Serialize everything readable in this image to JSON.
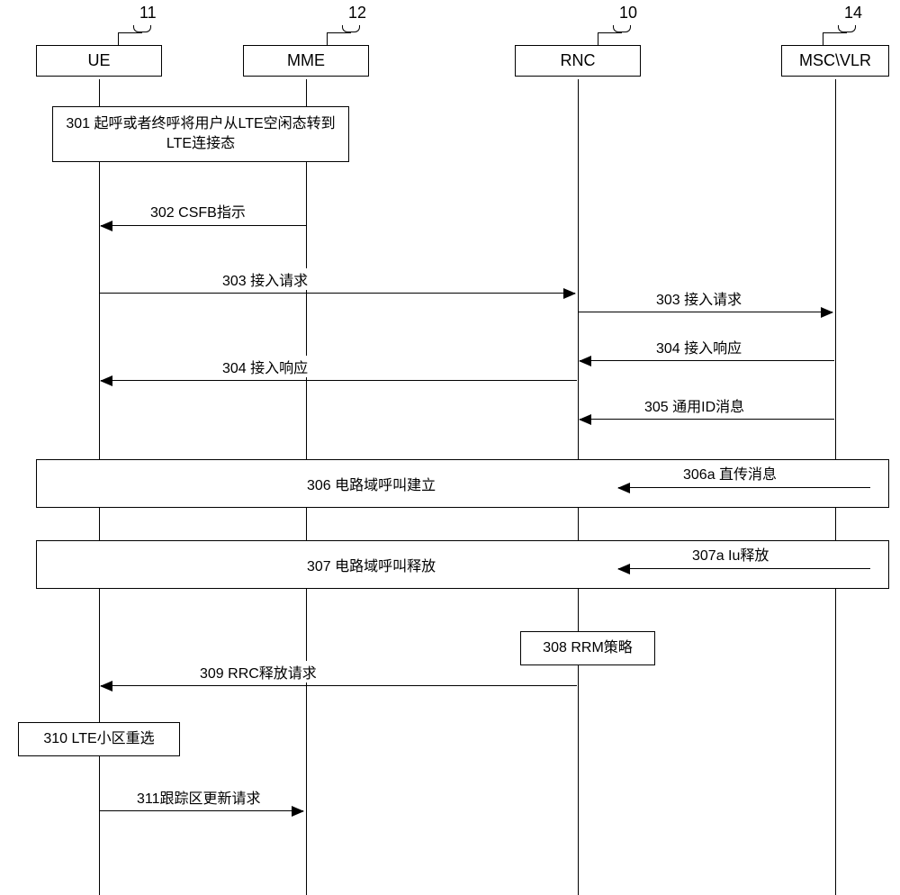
{
  "participants": {
    "ue": {
      "num": "11",
      "label": "UE"
    },
    "mme": {
      "num": "12",
      "label": "MME"
    },
    "rnc": {
      "num": "10",
      "label": "RNC"
    },
    "msc": {
      "num": "14",
      "label": "MSC\\VLR"
    }
  },
  "steps": {
    "s301": "301 起呼或者终呼将用户从LTE空闲态转到LTE连接态",
    "s302": "302 CSFB指示",
    "s303a": "303 接入请求",
    "s303b": "303 接入请求",
    "s304a": "304 接入响应",
    "s304b": "304 接入响应",
    "s305": "305 通用ID消息",
    "s306": "306 电路域呼叫建立",
    "s306a": "306a 直传消息",
    "s307": "307 电路域呼叫释放",
    "s307a": "307a Iu释放",
    "s308": "308 RRM策略",
    "s309": "309 RRC释放请求",
    "s310": "310 LTE小区重选",
    "s311": "311跟踪区更新请求"
  },
  "chart_data": {
    "type": "sequence-diagram",
    "participants": [
      {
        "id": "UE",
        "ref": "11"
      },
      {
        "id": "MME",
        "ref": "12"
      },
      {
        "id": "RNC",
        "ref": "10"
      },
      {
        "id": "MSC\\VLR",
        "ref": "14"
      }
    ],
    "messages": [
      {
        "step": "301",
        "from": "UE",
        "to": "MME",
        "type": "box",
        "text": "起呼或者终呼将用户从LTE空闲态转到LTE连接态"
      },
      {
        "step": "302",
        "from": "MME",
        "to": "UE",
        "type": "arrow",
        "text": "CSFB指示"
      },
      {
        "step": "303",
        "from": "UE",
        "to": "RNC",
        "type": "arrow",
        "text": "接入请求"
      },
      {
        "step": "303",
        "from": "RNC",
        "to": "MSC\\VLR",
        "type": "arrow",
        "text": "接入请求"
      },
      {
        "step": "304",
        "from": "MSC\\VLR",
        "to": "RNC",
        "type": "arrow",
        "text": "接入响应"
      },
      {
        "step": "304",
        "from": "RNC",
        "to": "UE",
        "type": "arrow",
        "text": "接入响应"
      },
      {
        "step": "305",
        "from": "MSC\\VLR",
        "to": "RNC",
        "type": "arrow",
        "text": "通用ID消息"
      },
      {
        "step": "306",
        "span": [
          "UE",
          "MSC\\VLR"
        ],
        "type": "box",
        "text": "电路域呼叫建立",
        "sub": {
          "step": "306a",
          "from": "MSC\\VLR",
          "to": "RNC",
          "text": "直传消息"
        }
      },
      {
        "step": "307",
        "span": [
          "UE",
          "MSC\\VLR"
        ],
        "type": "box",
        "text": "电路域呼叫释放",
        "sub": {
          "step": "307a",
          "from": "MSC\\VLR",
          "to": "RNC",
          "text": "Iu释放"
        }
      },
      {
        "step": "308",
        "at": "RNC",
        "type": "box",
        "text": "RRM策略"
      },
      {
        "step": "309",
        "from": "RNC",
        "to": "UE",
        "type": "arrow",
        "text": "RRC释放请求"
      },
      {
        "step": "310",
        "at": "UE",
        "type": "box",
        "text": "LTE小区重选"
      },
      {
        "step": "311",
        "from": "UE",
        "to": "MME",
        "type": "arrow",
        "text": "跟踪区更新请求"
      }
    ]
  }
}
